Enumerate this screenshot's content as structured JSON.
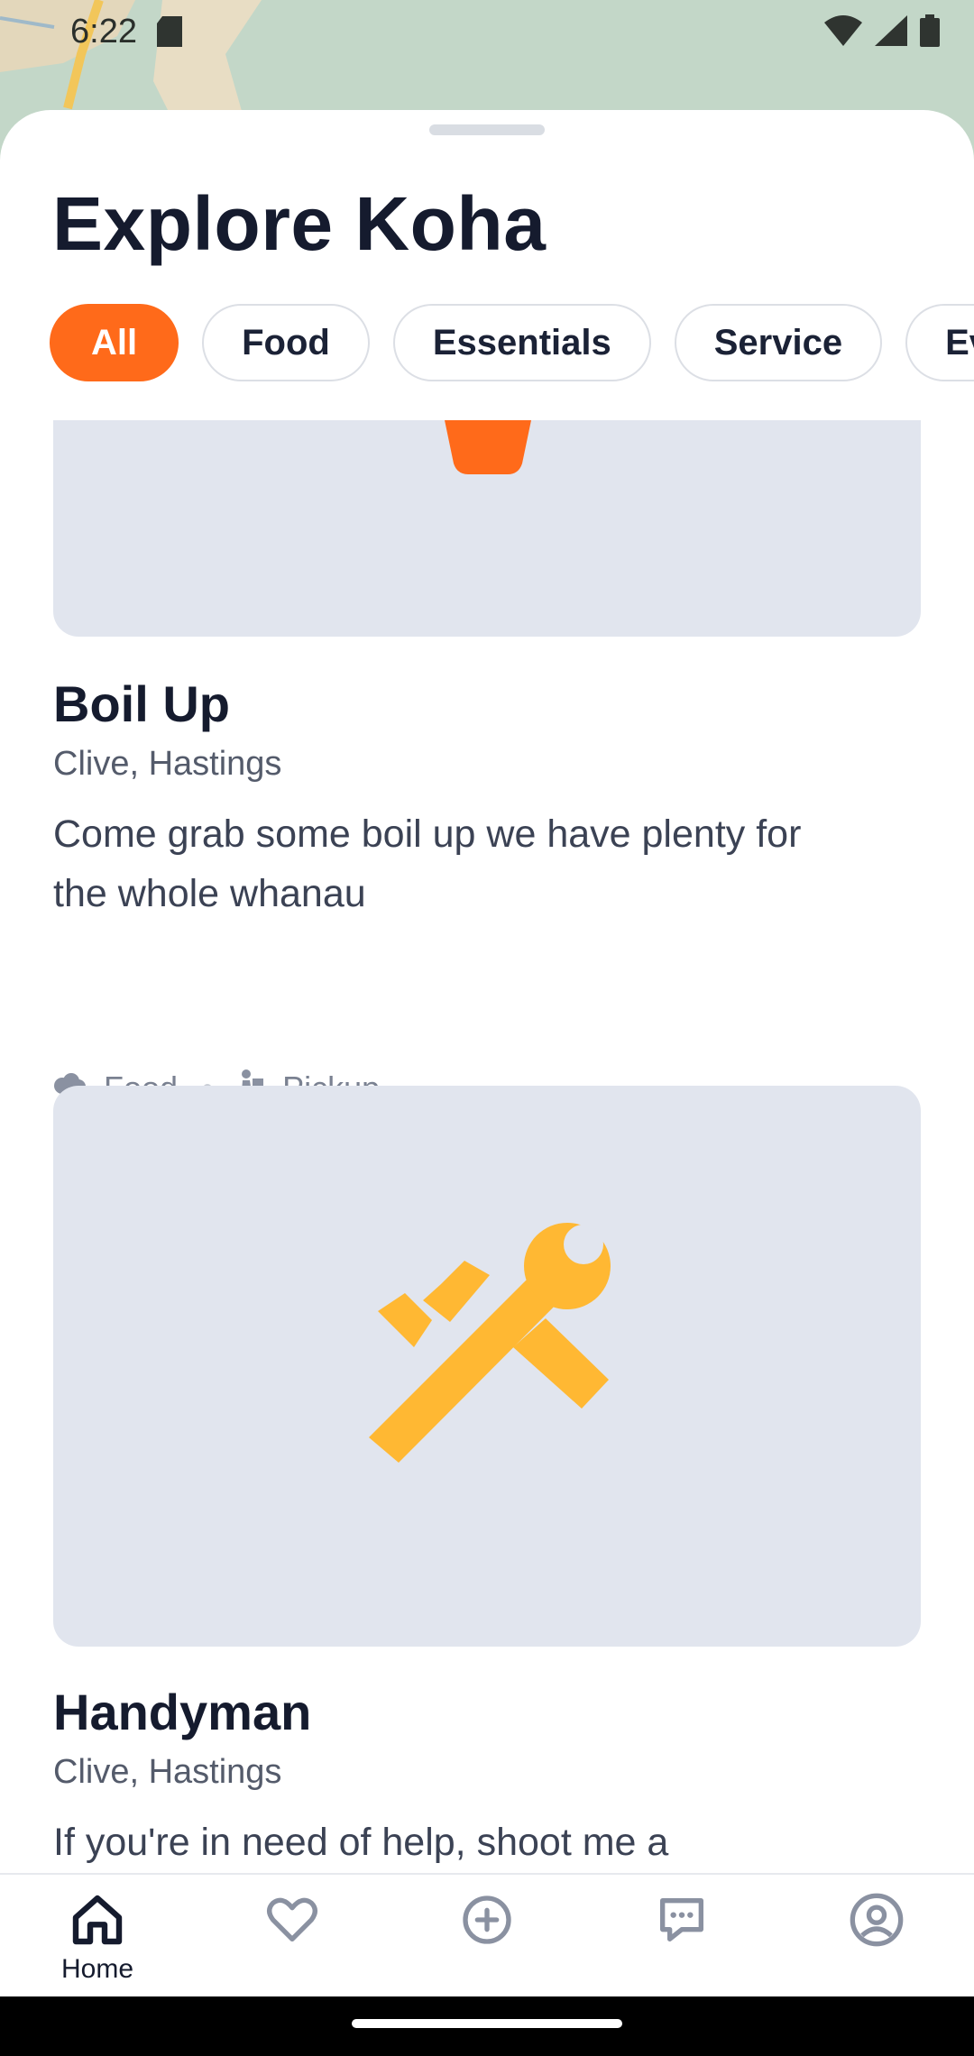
{
  "status_bar": {
    "time": "6:22"
  },
  "sheet": {
    "title": "Explore Koha"
  },
  "filters": [
    {
      "label": "All",
      "active": true
    },
    {
      "label": "Food",
      "active": false
    },
    {
      "label": "Essentials",
      "active": false
    },
    {
      "label": "Service",
      "active": false
    },
    {
      "label": "Ev",
      "active": false
    }
  ],
  "listings": [
    {
      "title": "Boil Up",
      "location": "Clive, Hastings",
      "description": "Come grab some boil up we have plenty for the whole whanau",
      "category": "Food",
      "delivery": "Pickup",
      "icon": "bowl-icon"
    },
    {
      "title": "Handyman",
      "location": "Clive, Hastings",
      "description": "If you're in need of help, shoot me a",
      "icon": "tools-icon"
    }
  ],
  "nav": [
    {
      "label": "Home",
      "icon": "home-icon"
    },
    {
      "label": "",
      "icon": "heart-icon"
    },
    {
      "label": "",
      "icon": "add-circle-icon"
    },
    {
      "label": "",
      "icon": "chat-icon"
    },
    {
      "label": "",
      "icon": "profile-icon"
    }
  ],
  "colors": {
    "accent": "#ff6a1a",
    "tools": "#ffb833",
    "card_bg": "#e1e5ee"
  }
}
